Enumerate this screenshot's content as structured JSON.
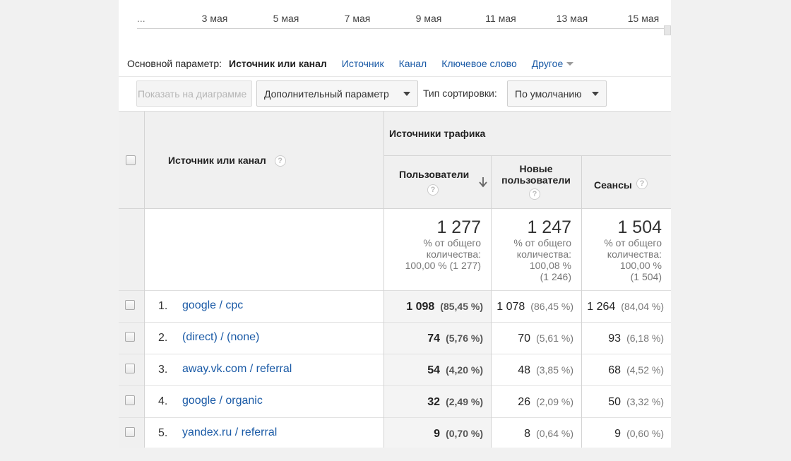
{
  "timeline": {
    "ticks": [
      "...",
      "3 мая",
      "5 мая",
      "7 мая",
      "9 мая",
      "11 мая",
      "13 мая",
      "15 мая"
    ]
  },
  "dimension_bar": {
    "label": "Основной параметр:",
    "current": "Источник или канал",
    "options": [
      "Источник",
      "Канал",
      "Ключевое слово"
    ],
    "other": "Другое"
  },
  "toolbar": {
    "show_chart": "Показать на диаграмме",
    "extra_param": "Дополнительный параметр",
    "sort_label": "Тип сортировки:",
    "sort_value": "По умолчанию"
  },
  "table": {
    "dim_header": "Источник или канал",
    "group_header": "Источники трафика",
    "columns": {
      "users": "Пользователи",
      "new_users": "Новые пользователи",
      "sessions": "Сеансы"
    },
    "help_glyph": "?",
    "totals": {
      "users": {
        "value": "1 277",
        "note_1": "% от общего",
        "note_2": "количества:",
        "note_3": "100,00 % (1 277)",
        "note_4": ""
      },
      "new_users": {
        "value": "1 247",
        "note_1": "% от общего",
        "note_2": "количества:",
        "note_3": "100,08 %",
        "note_4": "(1 246)"
      },
      "sessions": {
        "value": "1 504",
        "note_1": "% от общего",
        "note_2": "количества:",
        "note_3": "100,00 %",
        "note_4": "(1 504)"
      }
    },
    "rows": [
      {
        "num": "1.",
        "source": "google / cpc",
        "users": "1 098",
        "users_pct": "(85,45 %)",
        "new_users": "1 078",
        "new_users_pct": "(86,45 %)",
        "sessions": "1 264",
        "sessions_pct": "(84,04 %)"
      },
      {
        "num": "2.",
        "source": "(direct) / (none)",
        "users": "74",
        "users_pct": "(5,76 %)",
        "new_users": "70",
        "new_users_pct": "(5,61 %)",
        "sessions": "93",
        "sessions_pct": "(6,18 %)"
      },
      {
        "num": "3.",
        "source": "away.vk.com / referral",
        "users": "54",
        "users_pct": "(4,20 %)",
        "new_users": "48",
        "new_users_pct": "(3,85 %)",
        "sessions": "68",
        "sessions_pct": "(4,52 %)"
      },
      {
        "num": "4.",
        "source": "google / organic",
        "users": "32",
        "users_pct": "(2,49 %)",
        "new_users": "26",
        "new_users_pct": "(2,09 %)",
        "sessions": "50",
        "sessions_pct": "(3,32 %)"
      },
      {
        "num": "5.",
        "source": "yandex.ru / referral",
        "users": "9",
        "users_pct": "(0,70 %)",
        "new_users": "8",
        "new_users_pct": "(0,64 %)",
        "sessions": "9",
        "sessions_pct": "(0,60 %)"
      }
    ]
  }
}
